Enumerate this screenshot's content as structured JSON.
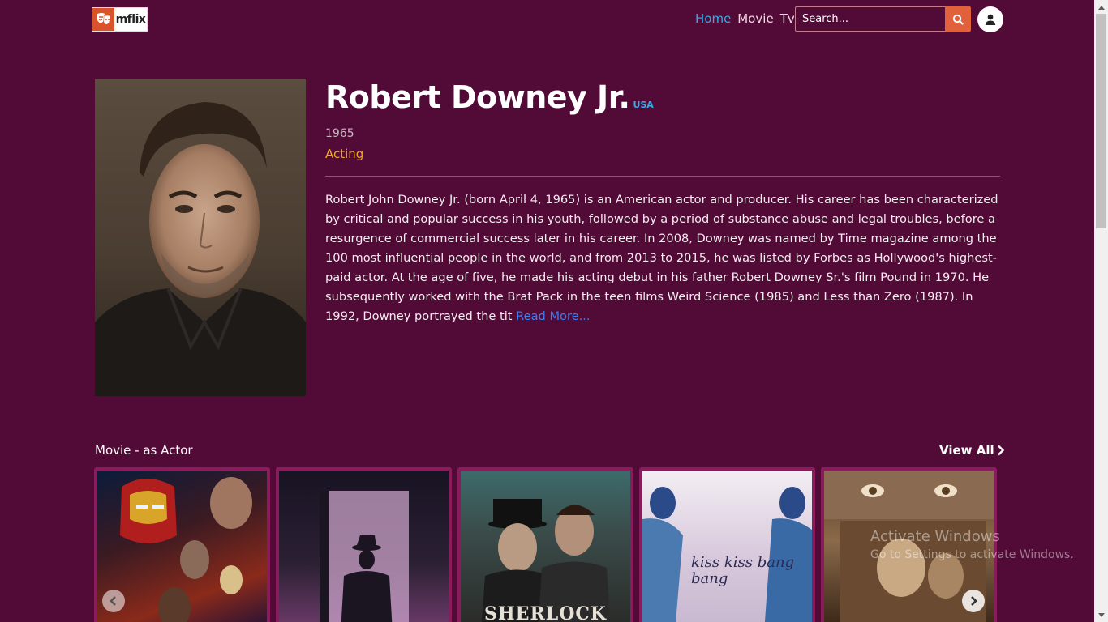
{
  "brand": {
    "logo_text": "mflix",
    "logo_icon": "theater-masks-icon",
    "accent": "#d9532b"
  },
  "nav": {
    "links": [
      {
        "label": "Home",
        "active": true
      },
      {
        "label": "Movie",
        "active": false
      },
      {
        "label": "Tv",
        "active": false
      }
    ],
    "search_placeholder": "Search...",
    "search_icon": "search-icon",
    "user_icon": "user-icon"
  },
  "person": {
    "name": "Robert Downey Jr.",
    "country": "USA",
    "birth_year": "1965",
    "department": "Acting",
    "bio": "Robert John Downey Jr. (born April 4, 1965) is an American actor and producer. His career has been characterized by critical and popular success in his youth, followed by a period of substance abuse and legal troubles, before a resurgence of commercial success later in his career. In 2008, Downey was named by Time magazine among the 100 most influential people in the world, and from 2013 to 2015, he was listed by Forbes as Hollywood's highest-paid actor. At the age of five, he made his acting debut in his father Robert Downey Sr.'s film Pound in 1970. He subsequently worked with the Brat Pack in the teen films Weird Science (1985) and Less than Zero (1987). In 1992, Downey portrayed the tit",
    "read_more": "Read More..."
  },
  "movies_section": {
    "title": "Movie - as Actor",
    "view_all": "View All",
    "posters": [
      {
        "poster_text": ""
      },
      {
        "poster_text": ""
      },
      {
        "poster_text": "SHERLOCK"
      },
      {
        "poster_text": "kiss kiss bang bang"
      },
      {
        "poster_text": ""
      }
    ]
  },
  "watermark": {
    "line1": "Activate Windows",
    "line2": "Go to Settings to activate Windows."
  },
  "colors": {
    "background": "#520a36",
    "link_active": "#3aa9e6",
    "department": "#f2a91f",
    "read_more": "#3d7ff0",
    "card_border": "#8a1c5e",
    "search_button": "#e0613b"
  }
}
